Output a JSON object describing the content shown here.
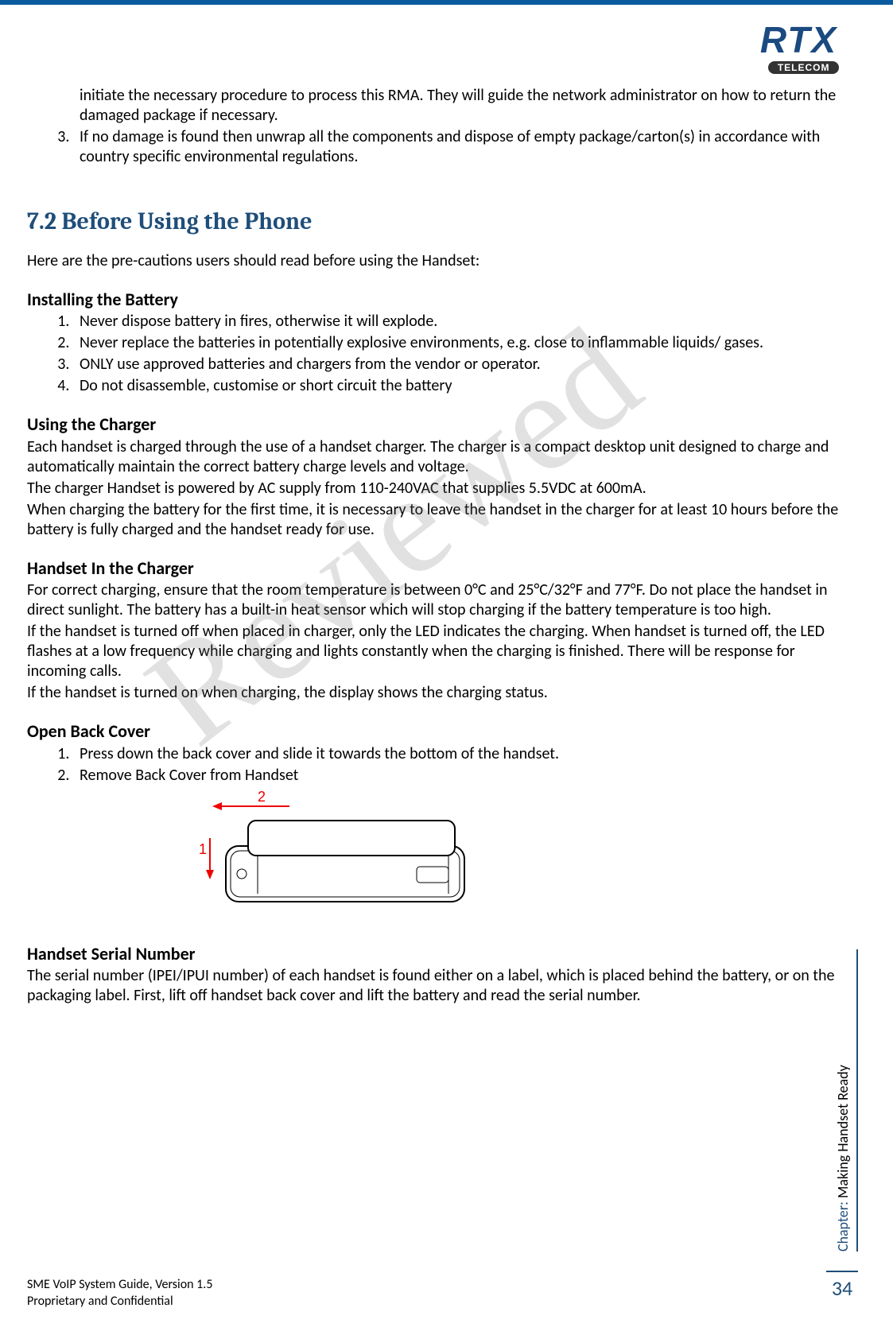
{
  "logo": {
    "main": "RTX",
    "sub": "TELECOM"
  },
  "watermark": "Reviewed",
  "intro_list": {
    "item2_cont": "initiate the necessary procedure to process this RMA.  They will guide the network administrator on how to return the damaged package if necessary.",
    "item3": "If no damage is found then unwrap all the components and dispose of empty package/carton(s) in accordance with country specific environmental regulations."
  },
  "heading_7_2": "7.2 Before Using the Phone",
  "intro_7_2": "Here are the pre-cautions users should read before using the Handset:",
  "installing_battery": {
    "heading": "Installing the Battery",
    "items": [
      "Never dispose battery in fires, otherwise it will explode.",
      "Never replace the batteries in potentially explosive environments, e.g. close to inflammable liquids/ gases.",
      "ONLY use approved batteries and chargers from the vendor or operator.",
      "Do not disassemble, customise or short circuit the battery"
    ]
  },
  "using_charger": {
    "heading": "Using the Charger",
    "p1": "Each handset is charged through the use of a handset charger. The charger is a compact desktop unit designed to charge and automatically maintain the correct battery charge levels and voltage.",
    "p2": "The charger Handset is powered by AC supply from 110-240VAC that supplies 5.5VDC at 600mA.",
    "p3": "When charging the battery for the first time, it is necessary to leave the handset in the charger for at least 10 hours before the battery is fully charged and the handset ready for use."
  },
  "handset_in_charger": {
    "heading": "Handset In the Charger",
    "p1": "For correct charging, ensure that the room temperature is between 0°C and 25°C/32°F and 77°F. Do not place the handset in direct sunlight. The battery has a built-in heat sensor which will stop charging if the battery temperature is too high.",
    "p2": "If the handset is turned off when placed in charger, only the LED indicates the charging. When handset is turned off, the LED flashes at a low frequency while charging and lights constantly when the charging is finished. There will be response for incoming calls.",
    "p3": "If the handset is turned on when charging, the display shows the charging status."
  },
  "open_back_cover": {
    "heading": "Open Back Cover",
    "items": [
      "Press down the back cover and slide it towards the bottom of the handset.",
      "Remove Back Cover from Handset"
    ],
    "diagram_labels": {
      "one": "1",
      "two": "2"
    }
  },
  "handset_serial": {
    "heading": "Handset Serial Number",
    "p1": "The serial number (IPEI/IPUI number) of each handset is found either on a label, which is placed behind the battery, or on the packaging label. First, lift off handset back cover and lift the battery and read the serial number."
  },
  "side_tab": {
    "label": "Chapter:",
    "name": " Making Handset Ready"
  },
  "page_number": "34",
  "footer": {
    "line1": "SME VoIP System Guide, Version 1.5",
    "line2": "Proprietary and Confidential"
  }
}
